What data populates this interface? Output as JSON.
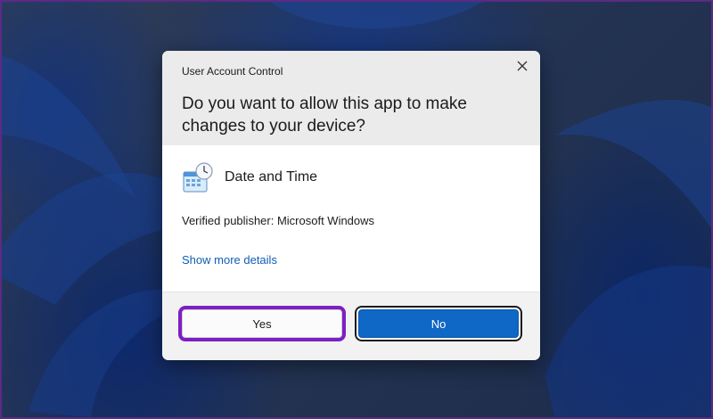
{
  "dialog": {
    "title": "User Account Control",
    "question": "Do you want to allow this app to make changes to your device?",
    "app_name": "Date and Time",
    "app_icon": "date-time-clock-icon",
    "publisher": "Verified publisher: Microsoft Windows",
    "more_details_link": "Show more details",
    "close_icon": "close-icon"
  },
  "buttons": {
    "yes_label": "Yes",
    "no_label": "No"
  },
  "colors": {
    "accent_button": "#0f67c6",
    "link": "#0f5fb3",
    "highlight_outline": "#7d1fc4",
    "page_border": "#5b2a86"
  }
}
